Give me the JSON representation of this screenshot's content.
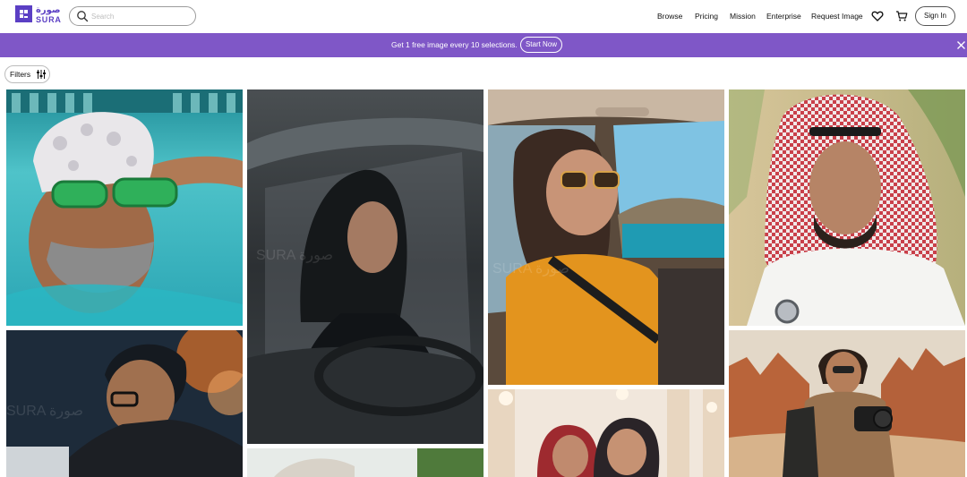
{
  "brand": {
    "arabic": "صورة",
    "name": "SURA"
  },
  "search": {
    "placeholder": "Search"
  },
  "nav": {
    "items": [
      {
        "label": "Browse"
      },
      {
        "label": "Pricing"
      },
      {
        "label": "Mission"
      },
      {
        "label": "Enterprise"
      },
      {
        "label": "Request Image"
      }
    ],
    "sign_in": "Sign In"
  },
  "banner": {
    "text": "Get 1 free image every 10 selections.",
    "cta": "Start Now"
  },
  "filters": {
    "label": "Filters"
  },
  "watermark": {
    "text": "SURA صورة"
  },
  "colors": {
    "brand": "#5b3fc4",
    "banner": "#7f57c7"
  }
}
